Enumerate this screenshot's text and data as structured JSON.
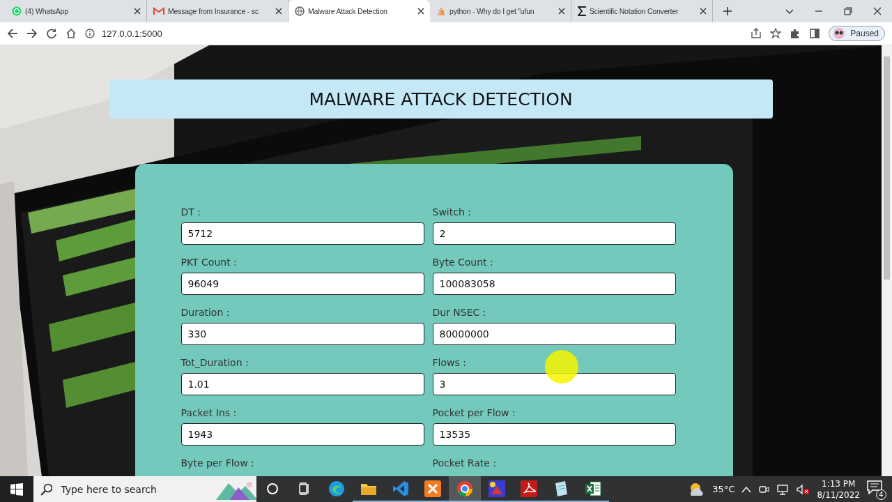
{
  "browser": {
    "tabs": [
      {
        "title": "(4) WhatsApp",
        "kind": "chat",
        "selected": false
      },
      {
        "title": "Message from Insurance - sc",
        "kind": "mail",
        "selected": false
      },
      {
        "title": "Malware Attack Detection",
        "kind": "globe",
        "selected": true
      },
      {
        "title": "python - Why do I get \"ufun",
        "kind": "stack",
        "selected": false
      },
      {
        "title": "Scientific Notation Converter",
        "kind": "sigma",
        "selected": false
      }
    ],
    "address": "127.0.0.1:5000",
    "profile": "Paused"
  },
  "page": {
    "heading": "MALWARE ATTACK DETECTION",
    "fields": [
      {
        "label": "DT :",
        "value": "5712"
      },
      {
        "label": "Switch :",
        "value": "2"
      },
      {
        "label": "PKT Count :",
        "value": "96049"
      },
      {
        "label": "Byte Count :",
        "value": "100083058"
      },
      {
        "label": "Duration :",
        "value": "330"
      },
      {
        "label": "Dur NSEC :",
        "value": "80000000"
      },
      {
        "label": "Tot_Duration :",
        "value": "1.01"
      },
      {
        "label": "Flows :",
        "value": "3"
      },
      {
        "label": "Packet Ins :",
        "value": "1943"
      },
      {
        "label": "Pocket per Flow :",
        "value": "13535"
      },
      {
        "label": "Byte per Flow :"
      },
      {
        "label": "Pocket Rate :"
      }
    ]
  },
  "taskbar": {
    "search": {
      "placeholder": "Type here to search"
    },
    "apps": [
      {
        "kind": "circle",
        "selected": false,
        "open": false
      },
      {
        "kind": "taskview",
        "selected": false,
        "open": false
      },
      {
        "kind": "edge",
        "selected": false,
        "open": false
      },
      {
        "kind": "folder",
        "selected": false,
        "open": true
      },
      {
        "kind": "code",
        "selected": false,
        "open": true
      },
      {
        "kind": "xampp",
        "selected": false,
        "open": true
      },
      {
        "kind": "chrome",
        "selected": true,
        "open": true
      },
      {
        "kind": "paint",
        "selected": false,
        "open": true
      },
      {
        "kind": "pdf",
        "selected": false,
        "open": true
      },
      {
        "kind": "notepad",
        "selected": false,
        "open": true
      },
      {
        "kind": "excel",
        "selected": false,
        "open": true
      }
    ],
    "temperature": "35°C",
    "time": "1:13 PM",
    "date": "8/11/2022",
    "notifications": "4"
  }
}
